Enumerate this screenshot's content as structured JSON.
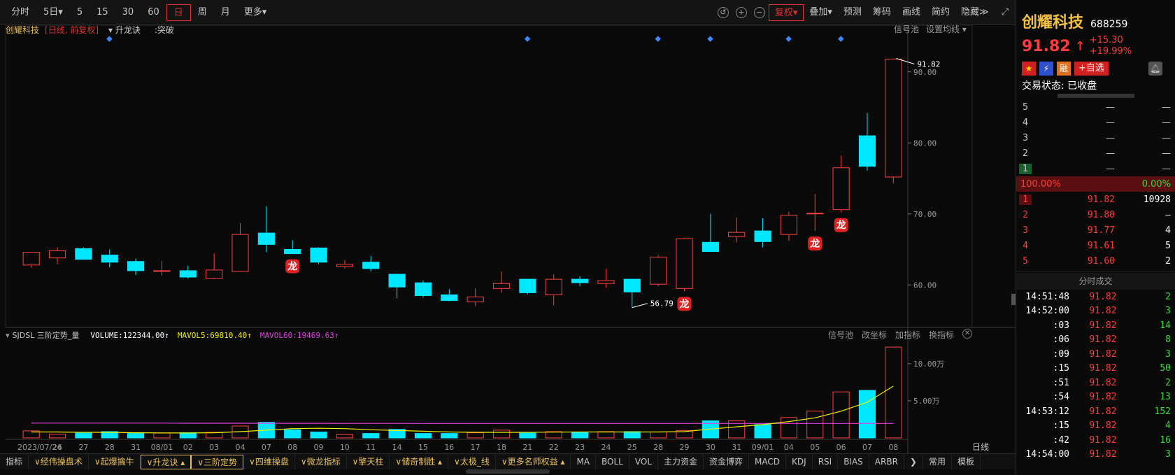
{
  "toolbar": {
    "periods": [
      "分时",
      "5日▾",
      "5",
      "15",
      "30",
      "60",
      "日",
      "周",
      "月",
      "更多▾"
    ],
    "active_period": "日",
    "right": [
      "复权▾",
      "叠加▾",
      "预测",
      "筹码",
      "画线",
      "简约",
      "隐藏≫"
    ]
  },
  "info": {
    "name": "创耀科技",
    "mode": "[日线, 前复权]",
    "indicator": "▾ 升龙诀",
    "signal": ":突破",
    "right_items": [
      "信号池",
      "设置均线 ▾"
    ]
  },
  "chart_data": [
    {
      "type": "candlestick",
      "dates": [
        "2023/07/24",
        "26",
        "27",
        "28",
        "31",
        "08/01",
        "02",
        "03",
        "04",
        "07",
        "08",
        "09",
        "10",
        "11",
        "14",
        "15",
        "16",
        "17",
        "18",
        "21",
        "22",
        "23",
        "24",
        "25",
        "28",
        "29",
        "30",
        "31",
        "09/01",
        "04",
        "05",
        "06",
        "07",
        "08"
      ],
      "open": [
        62.8,
        63.8,
        65.1,
        64.2,
        63.3,
        62.0,
        62.0,
        60.9,
        61.9,
        67.3,
        65.0,
        65.2,
        62.6,
        63.2,
        61.5,
        60.3,
        58.6,
        57.6,
        59.5,
        60.8,
        58.6,
        60.8,
        60.2,
        60.8,
        60.1,
        59.5,
        66.0,
        66.8,
        67.6,
        67.1,
        70.1,
        70.6,
        81.0,
        75.2
      ],
      "high": [
        63.0,
        65.3,
        65.3,
        65.0,
        63.7,
        63.4,
        62.7,
        64.4,
        68.7,
        71.1,
        66.3,
        65.3,
        63.5,
        64.1,
        61.6,
        60.6,
        59.4,
        59.5,
        61.9,
        60.8,
        61.5,
        61.2,
        62.3,
        60.8,
        64.2,
        66.6,
        70.0,
        69.5,
        69.4,
        70.3,
        72.8,
        78.2,
        84.2,
        91.9
      ],
      "low": [
        62.4,
        62.9,
        63.8,
        62.5,
        61.4,
        61.3,
        60.9,
        60.8,
        61.9,
        64.6,
        64.4,
        62.9,
        62.3,
        61.9,
        58.1,
        58.2,
        57.7,
        57.0,
        58.9,
        58.7,
        57.1,
        59.8,
        59.6,
        56.8,
        59.8,
        59.1,
        65.2,
        66.0,
        65.3,
        66.2,
        67.6,
        70.2,
        76.1,
        74.3
      ],
      "close": [
        64.6,
        64.8,
        63.6,
        63.2,
        62.0,
        62.0,
        61.1,
        62.1,
        67.1,
        65.7,
        64.4,
        63.2,
        62.9,
        62.3,
        59.7,
        58.5,
        57.8,
        58.3,
        60.2,
        58.9,
        60.8,
        60.3,
        60.6,
        59.0,
        63.9,
        66.5,
        64.7,
        67.4,
        66.1,
        69.8,
        70.1,
        76.5,
        76.7,
        91.8
      ],
      "ylim": [
        55,
        95
      ],
      "yticks": [
        "90.00",
        "80.00",
        "70.00",
        "60.00"
      ],
      "max_label": "91.82",
      "min_label": "56.79",
      "dragon_markers": [
        "29",
        "05",
        "06",
        "08"
      ]
    },
    {
      "type": "bar",
      "title": "SJDSL 三阶定势_量",
      "series": [
        {
          "name": "VOLUME",
          "label": "VOLUME:122344.00↑",
          "color": "#ffffff"
        },
        {
          "name": "MAVOL5",
          "label": "MAVOL5:69810.40↑",
          "color": "#f0f000"
        },
        {
          "name": "MAVOL60",
          "label": "MAVOL60:19469.63↑",
          "color": "#e040e0"
        }
      ],
      "values": [
        9000,
        9500,
        5000,
        6500,
        8500,
        7000,
        6500,
        7000,
        7500,
        16000,
        21000,
        11000,
        8000,
        4500,
        6000,
        11500,
        6000,
        6000,
        7000,
        10500,
        6500,
        8500,
        8000,
        8500,
        8500,
        8000,
        10000,
        23000,
        23000,
        18000,
        27500,
        36000,
        62000,
        64000,
        122344
      ],
      "mavol5": [
        8000,
        8000,
        8000,
        7500,
        7500,
        7000,
        6800,
        6700,
        7000,
        8500,
        10500,
        12500,
        13000,
        12500,
        11000,
        10000,
        9000,
        8000,
        7500,
        7500,
        7500,
        7800,
        8000,
        8000,
        8000,
        8000,
        8500,
        12000,
        15000,
        18000,
        22000,
        27000,
        36000,
        48000,
        69810
      ],
      "mavol60": [
        20000,
        20000,
        20000,
        20000,
        20000,
        20000,
        20000,
        19800,
        19800,
        19800,
        19700,
        19700,
        19700,
        19600,
        19600,
        19600,
        19500,
        19500,
        19500,
        19500,
        19500,
        19500,
        19500,
        19500,
        19500,
        19500,
        19500,
        19500,
        19500,
        19500,
        19500,
        19500,
        19500,
        19500,
        19470
      ],
      "ylim": [
        0,
        130000
      ],
      "yticks": [
        "10.00万",
        "5.00万"
      ],
      "right_items": [
        "信号池",
        "改坐标",
        "加指标",
        "换指标"
      ]
    }
  ],
  "stock": {
    "name": "创耀科技",
    "code": "688259",
    "price": "91.82",
    "arrow": "↑",
    "change": "+15.30",
    "pct": "+19.99%",
    "status": "交易状态: 已收盘",
    "badge_rong": "融",
    "add_watch": "+自选"
  },
  "orderbook": {
    "asks": [
      {
        "lv": "5",
        "p": "—",
        "v": "—"
      },
      {
        "lv": "4",
        "p": "—",
        "v": "—"
      },
      {
        "lv": "3",
        "p": "—",
        "v": "—"
      },
      {
        "lv": "2",
        "p": "—",
        "v": "—"
      },
      {
        "lv": "1",
        "p": "—",
        "v": "—"
      }
    ],
    "ratio_left": "100.00%",
    "ratio_right": "0.00%",
    "bids": [
      {
        "lv": "1",
        "p": "91.82",
        "v": "10928"
      },
      {
        "lv": "2",
        "p": "91.80",
        "v": "—"
      },
      {
        "lv": "3",
        "p": "91.77",
        "v": "4"
      },
      {
        "lv": "4",
        "p": "91.61",
        "v": "5"
      },
      {
        "lv": "5",
        "p": "91.60",
        "v": "2"
      }
    ]
  },
  "ticks_title": "分时成交",
  "ticks": [
    {
      "t": "14:51:48",
      "p": "91.82",
      "v": "2"
    },
    {
      "t": "14:52:00",
      "p": "91.82",
      "v": "3"
    },
    {
      "t": ":03",
      "p": "91.82",
      "v": "14"
    },
    {
      "t": ":06",
      "p": "91.82",
      "v": "8"
    },
    {
      "t": ":09",
      "p": "91.82",
      "v": "3"
    },
    {
      "t": ":15",
      "p": "91.82",
      "v": "50"
    },
    {
      "t": ":51",
      "p": "91.82",
      "v": "2"
    },
    {
      "t": ":54",
      "p": "91.82",
      "v": "13"
    },
    {
      "t": "14:53:12",
      "p": "91.82",
      "v": "152"
    },
    {
      "t": ":15",
      "p": "91.82",
      "v": "4"
    },
    {
      "t": ":42",
      "p": "91.82",
      "v": "16"
    },
    {
      "t": "14:54:00",
      "p": "91.82",
      "v": "3"
    }
  ],
  "bottom_tabs": [
    "指标",
    "∨经伟操盘术",
    "∨起爆擒牛",
    "∨升龙诀 ▴",
    "∨三阶定势",
    "∨四维操盘",
    "∨微龙指标",
    "∨擎天柱",
    "∨储奇制胜 ▴",
    "∨太极_线",
    "∨更多名师权益 ▴",
    "MA",
    "BOLL",
    "VOL",
    "主力资金",
    "资金博弈",
    "MACD",
    "KDJ",
    "RSI",
    "BIAS",
    "ARBR",
    "❯",
    "常用",
    "模板"
  ],
  "xaxis_label": "日线"
}
